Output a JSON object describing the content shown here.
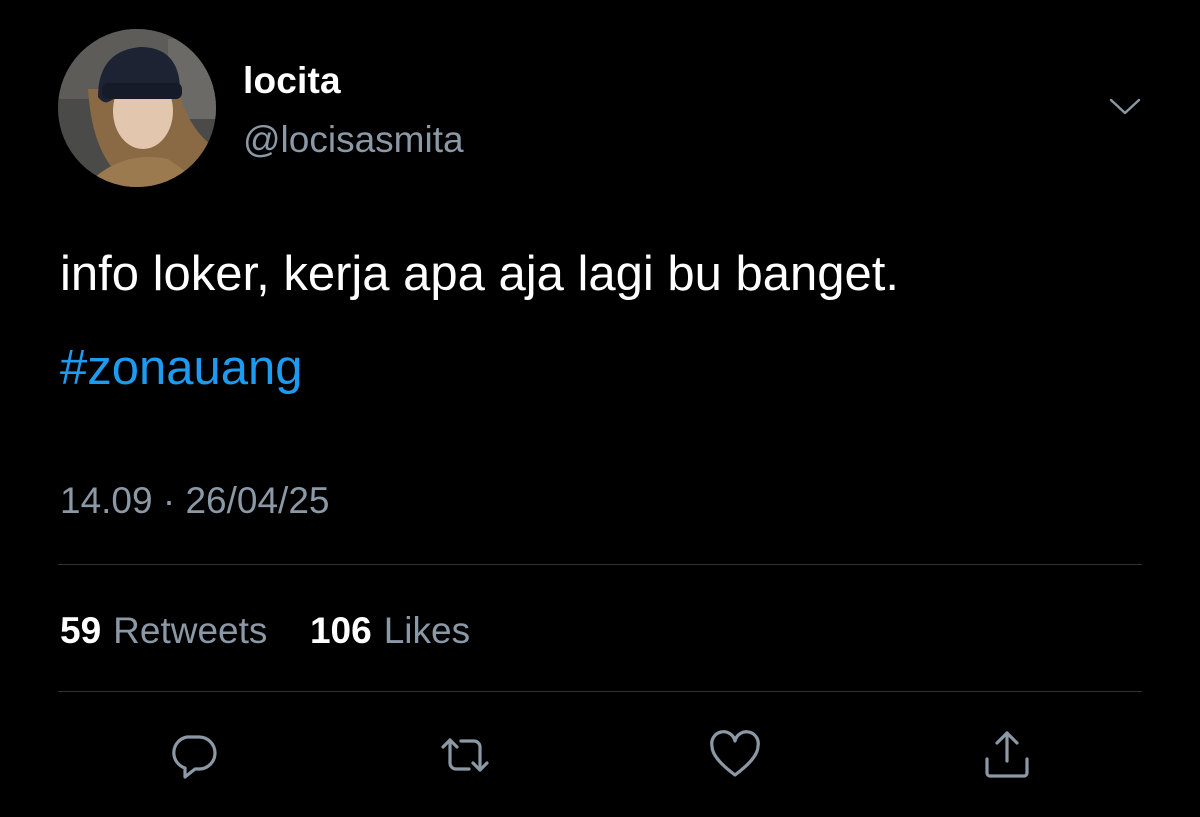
{
  "author": {
    "display_name": "locita",
    "handle": "@locisasmita"
  },
  "tweet": {
    "text": "info loker, kerja apa aja lagi bu banget.",
    "hashtag": "#zonauang",
    "timestamp": "14.09 · 26/04/25"
  },
  "stats": {
    "retweets_count": "59",
    "retweets_label": "Retweets",
    "likes_count": "106",
    "likes_label": "Likes"
  },
  "actions": [
    "reply-icon",
    "retweet-icon",
    "like-icon",
    "share-icon"
  ],
  "colors": {
    "background": "#000000",
    "text": "#ffffff",
    "secondary_text": "#8b98a5",
    "link": "#1d9bf0",
    "divider": "#2f3336"
  }
}
